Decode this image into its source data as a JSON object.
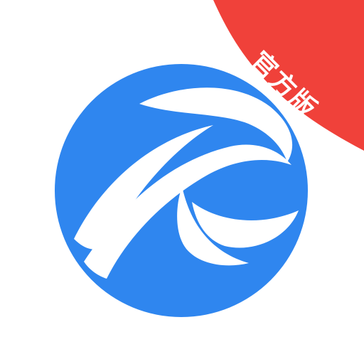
{
  "badge": {
    "label": "官方版",
    "color": "#F0413A"
  },
  "logo": {
    "primary_color": "#2F86EF",
    "icon_name": "swirl-eagle-logo"
  }
}
